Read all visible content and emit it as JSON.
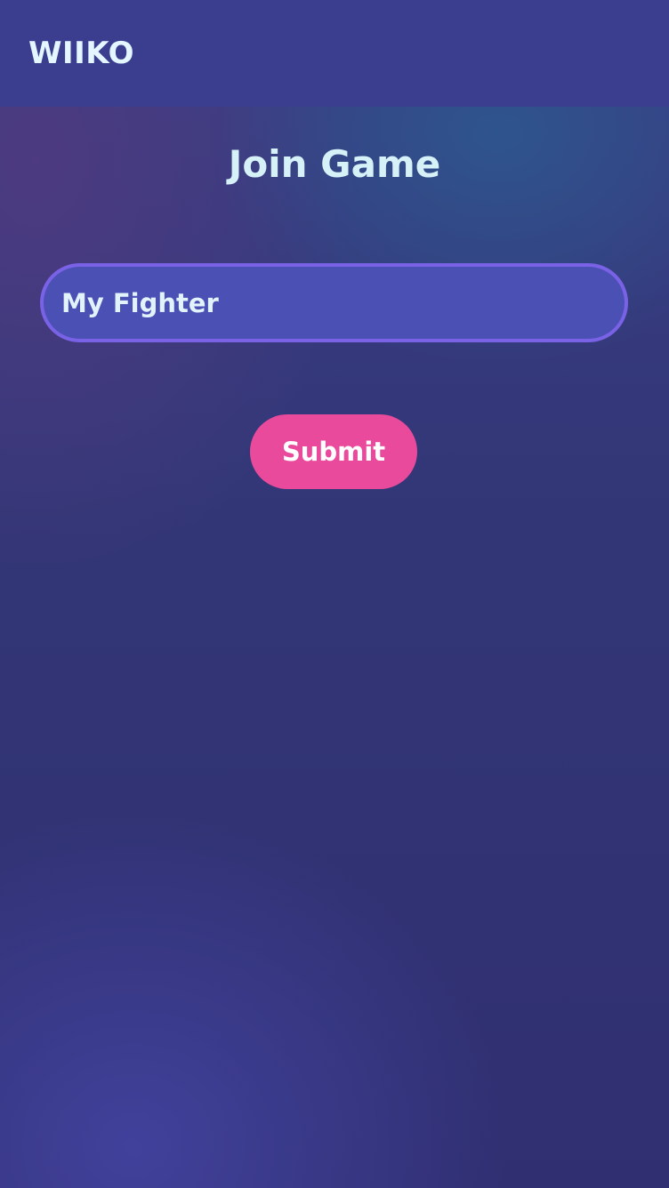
{
  "header": {
    "logo_text": "WIIKO"
  },
  "main": {
    "title": "Join Game",
    "name_input": {
      "value": "My Fighter",
      "placeholder": ""
    },
    "submit_label": "Submit"
  },
  "colors": {
    "header_bg": "#3b3d8e",
    "input_bg": "#4b50b4",
    "input_border": "#7a62e6",
    "submit_bg": "#ea4a9b",
    "title_text": "#d7f1f8"
  }
}
